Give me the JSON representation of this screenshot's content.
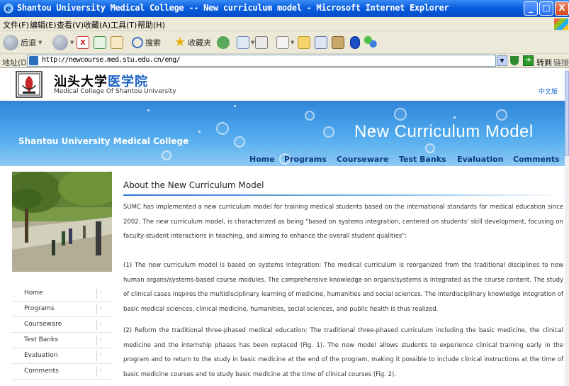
{
  "window": {
    "title": "Shantou University Medical College -- New curriculum model - Microsoft Internet Explorer",
    "minimize": "_",
    "maximize": "□",
    "close": "X"
  },
  "menubar": [
    "文件(F)",
    "编辑(E)",
    "查看(V)",
    "收藏(A)",
    "工具(T)",
    "帮助(H)"
  ],
  "toolbar": {
    "back_label": "后退",
    "search_label": "搜索",
    "favorites_label": "收藏夹"
  },
  "addressbar": {
    "label": "地址(D)",
    "url": "http://newcourse.med.stu.edu.cn/eng/",
    "go_label": "转到",
    "links_label": "链接"
  },
  "site": {
    "name_cn_black": "汕头大学",
    "name_cn_blue": "医学院",
    "name_en": "Medical College Of Shantou University",
    "lang_link": "中文版",
    "banner_left": "Shantou University Medical College",
    "banner_title": "New Curriculum Model"
  },
  "topnav": [
    "Home",
    "Programs",
    "Courseware",
    "Test Banks",
    "Evaluation",
    "Comments"
  ],
  "sidebar": {
    "items": [
      "Home",
      "Programs",
      "Courseware",
      "Test Banks",
      "Evaluation",
      "Comments"
    ],
    "arrow": "›"
  },
  "article": {
    "title": "About the New Curriculum Model",
    "paragraphs": [
      "SUMC has implemented a new curriculum model for training medical students based on the international standards for medical education since 2002. The new curriculum model, is characterized as being \"based on systems integration, centered on students' skill development, focusing on faculty-student interactions in teaching, and aiming to enhance the overall student qualities\":",
      "(1) The new curriculum model is based on systems integration: The medical curriculum is reorganized from the traditional disciplines to new human organs/systems-based course modules. The comprehensive knowledge on organs/systems is integrated as the course content. The study of clinical cases inspires the multidisciplinary learning of medicine, humanities and social sciences. The interdisciplinary knowledge integration of basic medical sciences, clinical medicine, humanities, social sciences, and public health is thus realized.",
      "(2) Reform the traditional three-phased medical education: The traditional three-phased curriculum including the basic medicine, the clinical medicine and the internship phases has been replaced (Fig. 1). The new model allows students to experience clinical training early in the program and to return to the study in basic medicine at the end of the program, making it possible to include clinical instructions at the time of basic medicine courses and to study basic medicine at the time of clinical courses (Fig. 2)."
    ]
  }
}
